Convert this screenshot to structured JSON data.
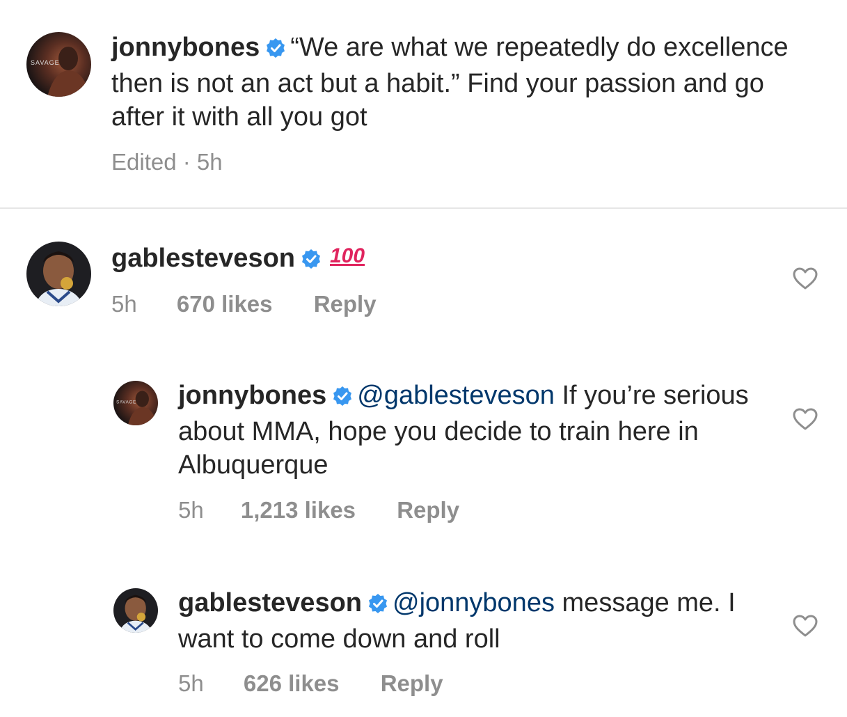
{
  "caption": {
    "username": "jonnybones",
    "text": "“We are what we repeatedly do excellence then is not an act but a habit.” Find your passion and go after it with all you got",
    "meta": "Edited · 5h",
    "avatar_text": "SAVAGE"
  },
  "comments": [
    {
      "username": "gablesteveson",
      "text": "100",
      "time": "5h",
      "likes": "670 likes",
      "reply": "Reply"
    },
    {
      "username": "jonnybones",
      "mention": "@gablesteveson",
      "text": " If you’re serious about MMA, hope you decide to train here in Albuquerque",
      "time": "5h",
      "likes": "1,213 likes",
      "reply": "Reply",
      "avatar_text": "SAVAGE"
    },
    {
      "username": "gablesteveson",
      "mention": "@jonnybones",
      "text": " message me. I want to come down and roll",
      "time": "5h",
      "likes": "626 likes",
      "reply": "Reply"
    }
  ],
  "colors": {
    "verified": "#3897f0",
    "mention": "#00376b",
    "meta": "#8e8e8e",
    "emoji": "#e0245e"
  }
}
